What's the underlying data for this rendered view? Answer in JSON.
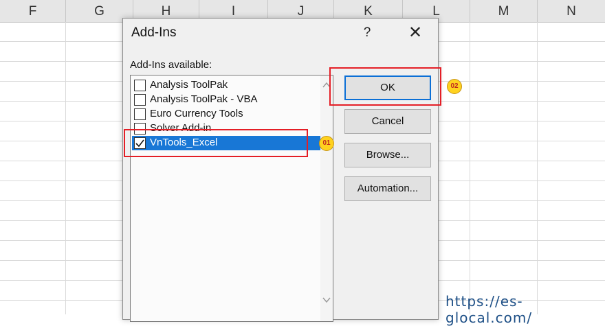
{
  "spreadsheet": {
    "columns": [
      "F",
      "G",
      "H",
      "I",
      "J",
      "K",
      "L",
      "M",
      "N"
    ]
  },
  "dialog": {
    "title": "Add-Ins",
    "help_label": "?",
    "close_label": "✕",
    "list_label": "Add-Ins available:",
    "items": [
      {
        "label": "Analysis ToolPak",
        "checked": false
      },
      {
        "label": "Analysis ToolPak - VBA",
        "checked": false
      },
      {
        "label": "Euro Currency Tools",
        "checked": false
      },
      {
        "label": "Solver Add-in",
        "checked": false
      },
      {
        "label": "VnTools_Excel",
        "checked": true,
        "selected": true
      }
    ],
    "buttons": {
      "ok": "OK",
      "cancel": "Cancel",
      "browse": "Browse...",
      "automation": "Automation..."
    }
  },
  "annotations": {
    "badge_1": "01",
    "badge_2": "02",
    "highlight_color": "#e41e26",
    "badge_color": "#ffd21f"
  },
  "watermark": {
    "url": "https://es-glocal.com/"
  },
  "colors": {
    "selection": "#1877d6",
    "dialog_bg": "#f0f0f0"
  }
}
